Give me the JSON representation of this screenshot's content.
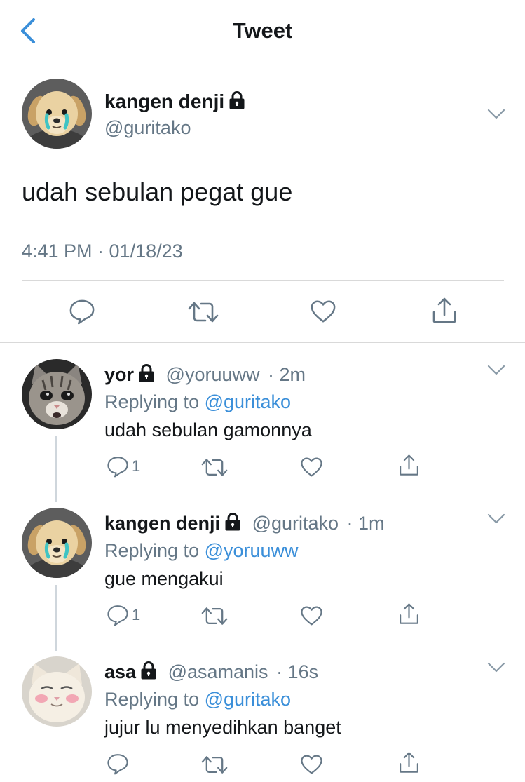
{
  "header": {
    "title": "Tweet",
    "back_icon": "chevron-left-icon"
  },
  "colors": {
    "accent": "#3b8fd9",
    "secondary_text": "#657786",
    "primary_text": "#14171a",
    "divider": "#d9d9d9"
  },
  "main_tweet": {
    "display_name": "kangen denji",
    "handle": "@guritako",
    "text": "udah sebulan pegat gue",
    "timestamp": "4:41 PM · 01/18/23",
    "actions": [
      "reply-icon",
      "retweet-icon",
      "like-icon",
      "share-icon"
    ]
  },
  "replies": [
    {
      "display_name": "yor",
      "handle": "@yoruuww",
      "time": "· 2m",
      "replying_label": "Replying to",
      "replying_to": "@guritako",
      "text": "udah sebulan gamonnya",
      "reply_count": "1"
    },
    {
      "display_name": "kangen denji",
      "handle": "@guritako",
      "time": "· 1m",
      "replying_label": "Replying to",
      "replying_to": "@yoruuww",
      "text": "gue mengakui",
      "reply_count": "1"
    },
    {
      "display_name": "asa",
      "handle": "@asamanis",
      "time": "· 16s",
      "replying_label": "Replying to",
      "replying_to": "@guritako",
      "text": "jujur lu menyedihkan banget",
      "reply_count": ""
    }
  ]
}
